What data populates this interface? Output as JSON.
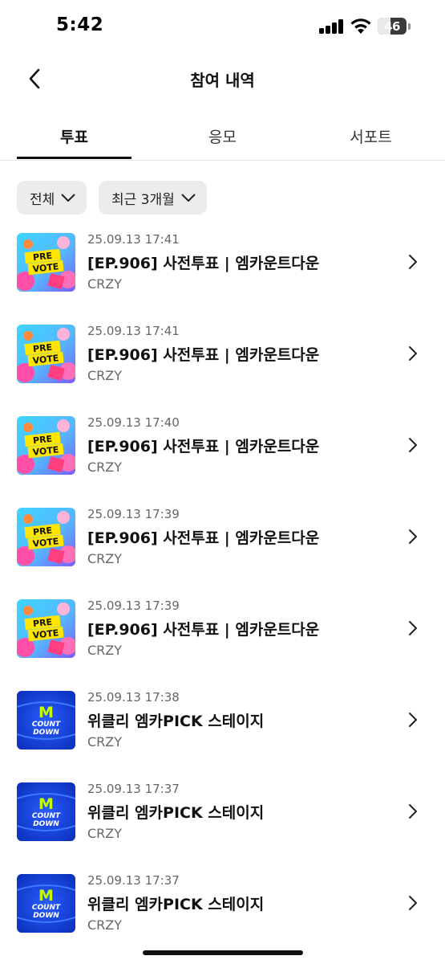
{
  "status_bar": {
    "time": "5:42",
    "battery": "46"
  },
  "nav": {
    "title": "참여 내역"
  },
  "tabs": [
    {
      "label": "투표"
    },
    {
      "label": "응모"
    },
    {
      "label": "서포트"
    }
  ],
  "filters": {
    "category": "전체",
    "period": "최근 3개월"
  },
  "thumbnails": {
    "prevote_line1": "PRE",
    "prevote_line2": "VOTE",
    "countdown_m": "M",
    "countdown_line1": "COUNT",
    "countdown_line2": "DOWN"
  },
  "items": [
    {
      "date": "25.09.13 17:41",
      "title": "[EP.906] 사전투표 | 엠카운트다운",
      "sub": "CRZY",
      "thumb": "prevote"
    },
    {
      "date": "25.09.13 17:41",
      "title": "[EP.906] 사전투표 | 엠카운트다운",
      "sub": "CRZY",
      "thumb": "prevote"
    },
    {
      "date": "25.09.13 17:40",
      "title": "[EP.906] 사전투표 | 엠카운트다운",
      "sub": "CRZY",
      "thumb": "prevote"
    },
    {
      "date": "25.09.13 17:39",
      "title": "[EP.906] 사전투표 | 엠카운트다운",
      "sub": "CRZY",
      "thumb": "prevote"
    },
    {
      "date": "25.09.13 17:39",
      "title": "[EP.906] 사전투표 | 엠카운트다운",
      "sub": "CRZY",
      "thumb": "prevote"
    },
    {
      "date": "25.09.13 17:38",
      "title": "위클리 엠카PICK 스테이지",
      "sub": "CRZY",
      "thumb": "countdown"
    },
    {
      "date": "25.09.13 17:37",
      "title": "위클리 엠카PICK 스테이지",
      "sub": "CRZY",
      "thumb": "countdown"
    },
    {
      "date": "25.09.13 17:37",
      "title": "위클리 엠카PICK 스테이지",
      "sub": "CRZY",
      "thumb": "countdown"
    }
  ]
}
